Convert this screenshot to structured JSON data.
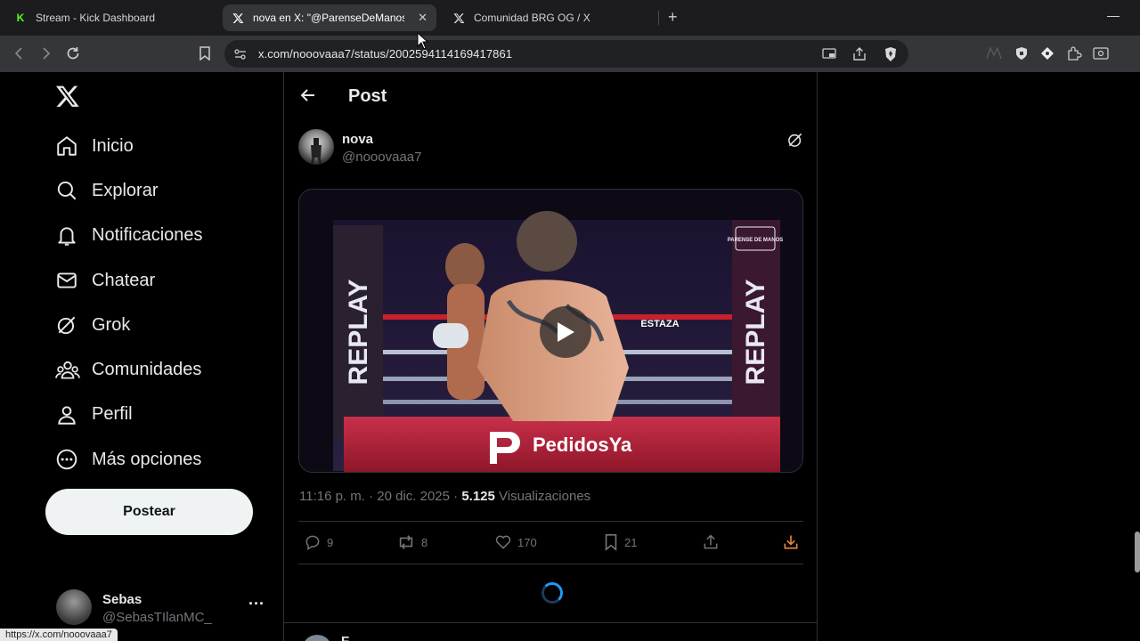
{
  "browser": {
    "tabs": [
      {
        "label": "Stream - Kick Dashboard",
        "icon": "kick-icon"
      },
      {
        "label": "nova en X: \"@ParenseDeManos",
        "icon": "x-icon",
        "active": true
      },
      {
        "label": "Comunidad BRG OG / X",
        "icon": "x-icon"
      }
    ],
    "new_tab": "+",
    "minimize": "—",
    "url": "x.com/nooovaaa7/status/2002594114169417861",
    "status_url": "https://x.com/nooovaaa7"
  },
  "nav": {
    "items": [
      {
        "label": "Inicio",
        "icon": "home-icon"
      },
      {
        "label": "Explorar",
        "icon": "search-icon"
      },
      {
        "label": "Notificaciones",
        "icon": "bell-icon"
      },
      {
        "label": "Chatear",
        "icon": "mail-icon"
      },
      {
        "label": "Grok",
        "icon": "grok-icon"
      },
      {
        "label": "Comunidades",
        "icon": "communities-icon"
      },
      {
        "label": "Perfil",
        "icon": "person-icon"
      },
      {
        "label": "Más opciones",
        "icon": "more-circle-icon"
      }
    ],
    "post_button": "Postear"
  },
  "account": {
    "name": "Sebas",
    "handle": "@SebasTIlanMC_",
    "more": "···"
  },
  "header": {
    "title": "Post"
  },
  "post": {
    "author_name": "nova",
    "author_handle": "@nooovaaa7",
    "timestamp": "11:16 p. m. · 20 dic. 2025 · ",
    "views_count": "5.125",
    "views_label": " Visualizaciones",
    "video": {
      "left_banner": "REPLAY",
      "right_banner": "REPLAY",
      "sponsor": "PedidosYa",
      "corner_logo": "PARENSE DE MANOS",
      "ring_banner": "ESTAZA"
    },
    "actions": {
      "replies": "9",
      "reposts": "8",
      "likes": "170",
      "bookmarks": "21"
    }
  },
  "next_post": {
    "name": "F"
  },
  "colors": {
    "accent": "#1d9bf0",
    "download": "#f0883e",
    "muted": "#71767b",
    "background": "#000000"
  }
}
